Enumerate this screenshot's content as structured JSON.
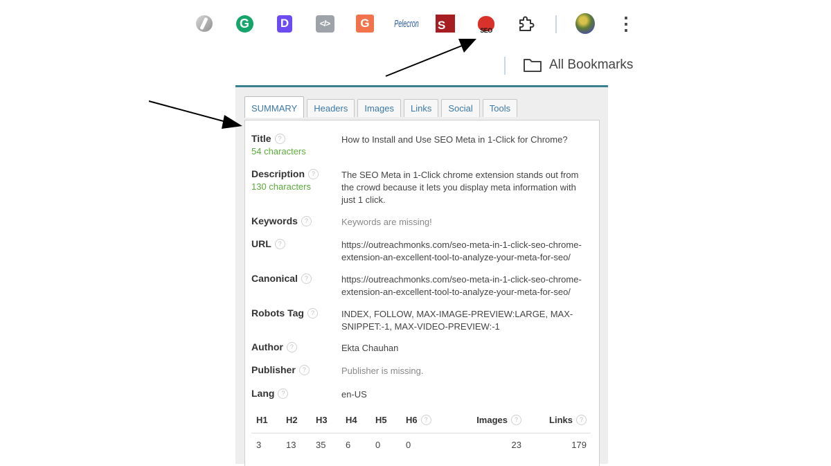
{
  "toolbar": {
    "extensions": [
      {
        "name": "s-gray-extension",
        "icon": "stylized-s-icon",
        "color": "#9a9a9a"
      },
      {
        "name": "grammarly-extension",
        "icon": "grammarly-g-icon",
        "glyph": "G",
        "color": "#15a56a"
      },
      {
        "name": "d-extension",
        "icon": "d-letter-icon",
        "glyph": "D",
        "color": "#6c4bf0"
      },
      {
        "name": "code-extension",
        "icon": "code-brackets-icon",
        "glyph": "</>",
        "color": "#9ea3aa"
      },
      {
        "name": "g-orange-extension",
        "icon": "g-letter-icon",
        "glyph": "G",
        "color": "#f0734b"
      },
      {
        "name": "pelecron-extension",
        "icon": "pelecron-text-icon",
        "glyph": "Pelecron",
        "color": "#2a5aa8"
      },
      {
        "name": "s-red-extension",
        "icon": "s-red-square-icon",
        "glyph": "S",
        "color": "#a71e22"
      },
      {
        "name": "seo-meta-extension",
        "icon": "seo-meta-icon",
        "glyph": "SEO",
        "color": "#d9322a"
      }
    ],
    "puzzle_icon": "extensions-puzzle-icon",
    "avatar_icon": "profile-avatar-icon",
    "menu_glyph": "⋮"
  },
  "bookmarks": {
    "label": "All Bookmarks",
    "icon": "folder-icon"
  },
  "tabs": [
    {
      "label": "SUMMARY",
      "active": true
    },
    {
      "label": "Headers"
    },
    {
      "label": "Images"
    },
    {
      "label": "Links"
    },
    {
      "label": "Social"
    },
    {
      "label": "Tools"
    }
  ],
  "help_glyph": "?",
  "summary": {
    "title": {
      "label": "Title",
      "count": "54 characters",
      "value": "How to Install and Use SEO Meta in 1-Click for Chrome?"
    },
    "description": {
      "label": "Description",
      "count": "130 characters",
      "value": "The SEO Meta in 1-Click chrome extension stands out from the crowd because it lets you display meta information with just 1 click."
    },
    "keywords": {
      "label": "Keywords",
      "value": "Keywords are missing!"
    },
    "url": {
      "label": "URL",
      "value": "https://outreachmonks.com/seo-meta-in-1-click-seo-chrome-extension-an-excellent-tool-to-analyze-your-meta-for-seo/"
    },
    "canonical": {
      "label": "Canonical",
      "value": "https://outreachmonks.com/seo-meta-in-1-click-seo-chrome-extension-an-excellent-tool-to-analyze-your-meta-for-seo/"
    },
    "robots": {
      "label": "Robots Tag",
      "value": "INDEX, FOLLOW, MAX-IMAGE-PREVIEW:LARGE, MAX-SNIPPET:-1, MAX-VIDEO-PREVIEW:-1"
    },
    "author": {
      "label": "Author",
      "value": "Ekta Chauhan"
    },
    "publisher": {
      "label": "Publisher",
      "value": "Publisher is missing."
    },
    "lang": {
      "label": "Lang",
      "value": "en-US"
    }
  },
  "headers_table": {
    "columns": [
      "H1",
      "H2",
      "H3",
      "H4",
      "H5",
      "H6",
      "Images",
      "Links"
    ],
    "values": [
      "3",
      "13",
      "35",
      "6",
      "0",
      "0",
      "23",
      "179"
    ]
  },
  "colors": {
    "accent_bar": "#3a8090",
    "tab_text": "#3b79a8",
    "count_green": "#5aac3a",
    "arrow": "#000000"
  }
}
